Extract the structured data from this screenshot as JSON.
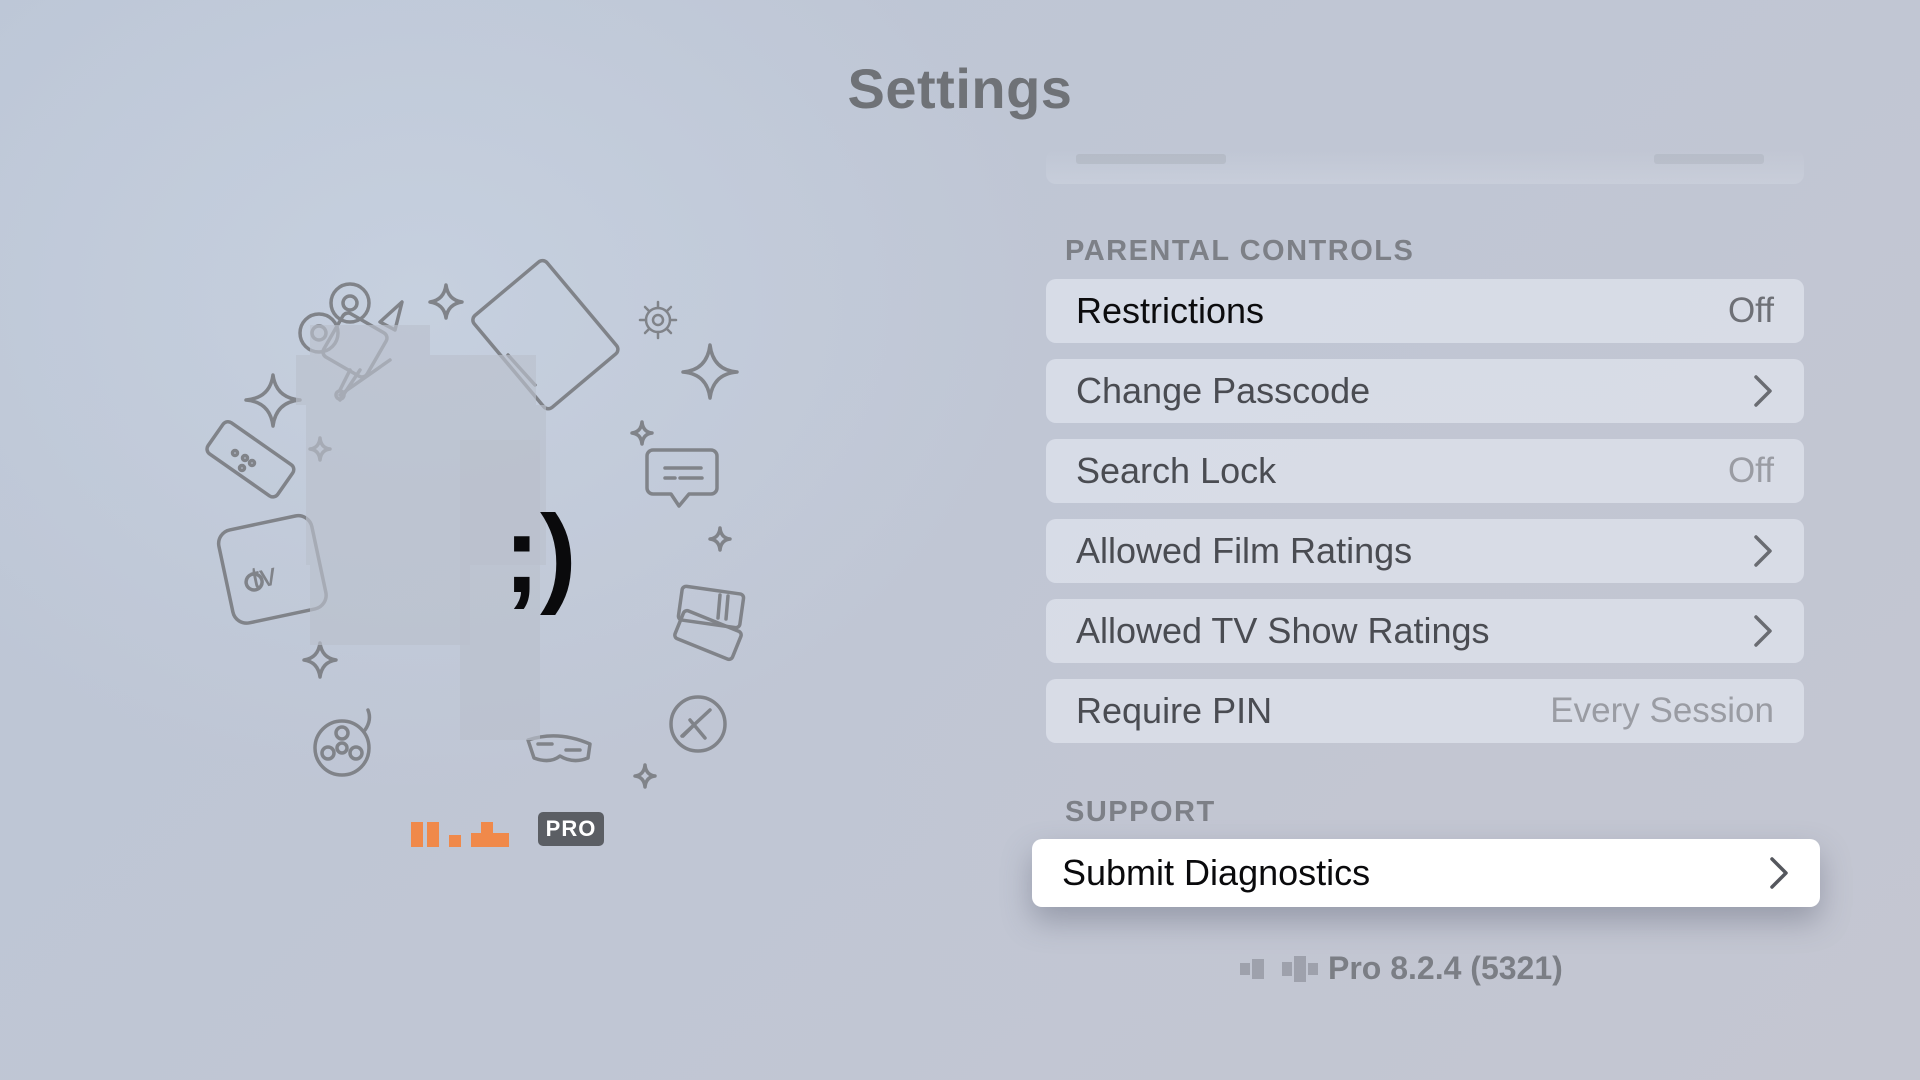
{
  "page": {
    "title": "Settings"
  },
  "illustration": {
    "wink_text": ";)",
    "brand_badge": "PRO",
    "icons": [
      "film-camera-icon",
      "sparkle-icon",
      "tablet-icon",
      "gear-icon",
      "remote-icon",
      "apple-tv-box-icon",
      "subtitles-icon",
      "tickets-icon",
      "film-reel-icon",
      "3d-glasses-icon",
      "kodi-logo-icon"
    ]
  },
  "parental_controls": {
    "header": "PARENTAL CONTROLS",
    "items": [
      {
        "label": "Restrictions",
        "value": "Off",
        "chevron": false
      },
      {
        "label": "Change Passcode",
        "value": "",
        "chevron": true
      },
      {
        "label": "Search Lock",
        "value": "Off",
        "chevron": false
      },
      {
        "label": "Allowed Film Ratings",
        "value": "",
        "chevron": true
      },
      {
        "label": "Allowed TV Show Ratings",
        "value": "",
        "chevron": true
      },
      {
        "label": "Require PIN",
        "value": "Every Session",
        "chevron": false
      }
    ]
  },
  "support": {
    "header": "SUPPORT",
    "items": [
      {
        "label": "Submit Diagnostics",
        "value": "",
        "chevron": true,
        "focused": true
      }
    ]
  },
  "footer": {
    "version": "Pro 8.2.4 (5321)"
  },
  "colors": {
    "accent_orange": "#f0894a",
    "focus_white": "#ffffff",
    "badge_gray": "#5b5e64"
  }
}
